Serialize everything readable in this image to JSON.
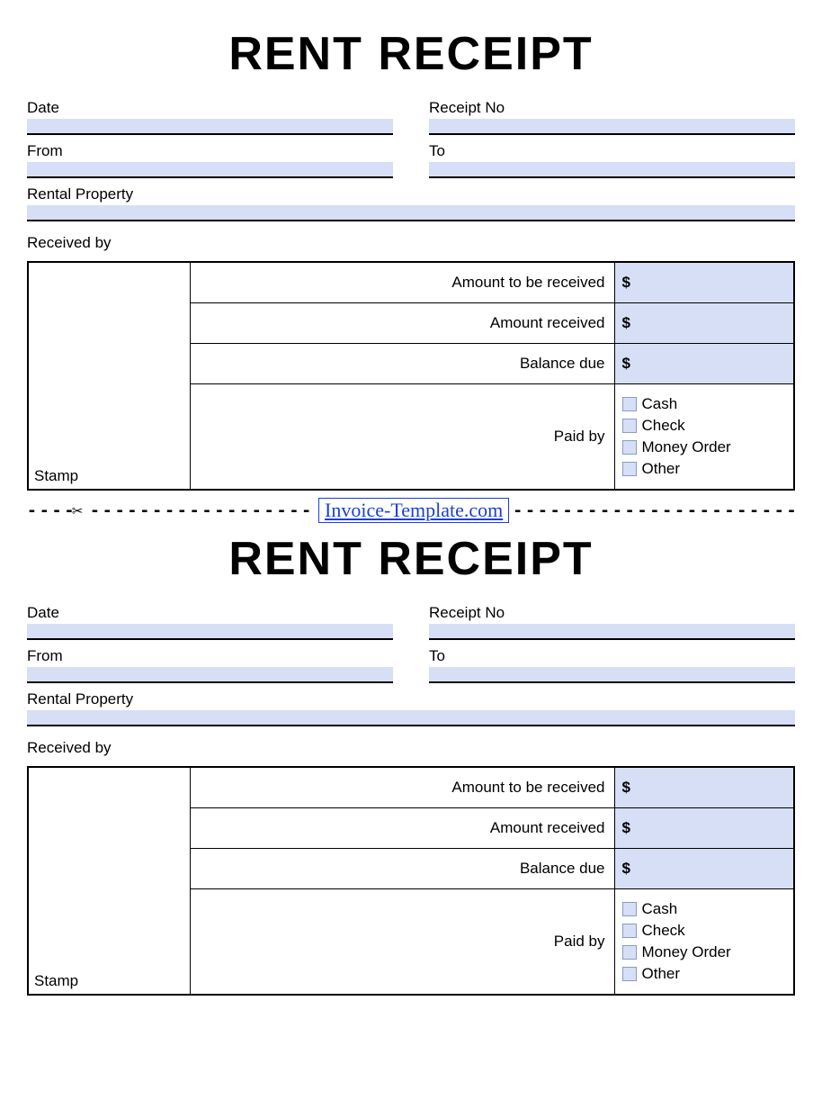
{
  "title": "RENT RECEIPT",
  "fields": {
    "date": "Date",
    "receipt_no": "Receipt No",
    "from": "From",
    "to": "To",
    "rental_property": "Rental Property",
    "received_by": "Received by",
    "stamp": "Stamp"
  },
  "amounts": {
    "to_be_received_label": "Amount to be received",
    "received_label": "Amount received",
    "balance_label": "Balance due",
    "currency": "$",
    "paid_by_label": "Paid by"
  },
  "payment_options": [
    "Cash",
    "Check",
    "Money Order",
    "Other"
  ],
  "separator": {
    "link_text": "Invoice-Template.com"
  }
}
